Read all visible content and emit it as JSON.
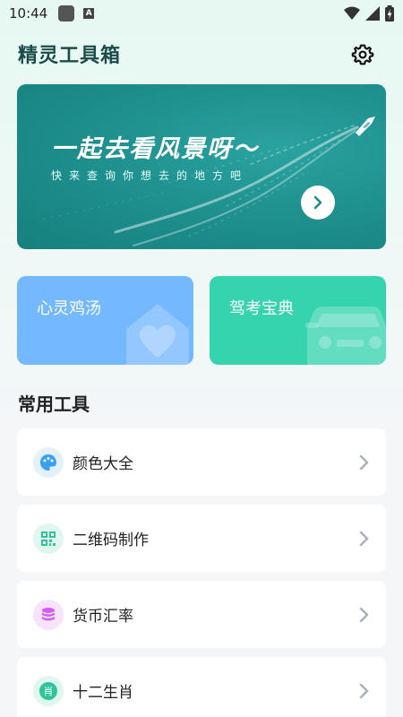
{
  "status_bar": {
    "time": "10:44",
    "icons": [
      "notification-square-icon",
      "keyboard-a-icon",
      "wifi-icon",
      "signal-icon",
      "battery-charging-icon"
    ],
    "a_glyph": "A"
  },
  "header": {
    "title": "精灵工具箱",
    "settings_icon": "gear-icon"
  },
  "banner": {
    "title": "一起去看风景呀～",
    "subtitle": "快来查询你想去的地方吧",
    "next_icon": "chevron-right-icon"
  },
  "cards": [
    {
      "label": "心灵鸡汤",
      "color": "#74b8ff",
      "icon": "house-heart-icon"
    },
    {
      "label": "驾考宝典",
      "color": "#36d4ae",
      "icon": "car-icon"
    }
  ],
  "section": {
    "title": "常用工具"
  },
  "tools": [
    {
      "label": "颜色大全",
      "icon": "palette-icon",
      "icon_color": "#3aa0f4"
    },
    {
      "label": "二维码制作",
      "icon": "qr-code-icon",
      "icon_color": "#2fc59a"
    },
    {
      "label": "货币汇率",
      "icon": "coin-stack-icon",
      "icon_color": "#d45cf0"
    },
    {
      "label": "十二生肖",
      "icon": "zodiac-icon",
      "icon_color": "#2fc59a",
      "icon_glyph": "肖"
    }
  ]
}
